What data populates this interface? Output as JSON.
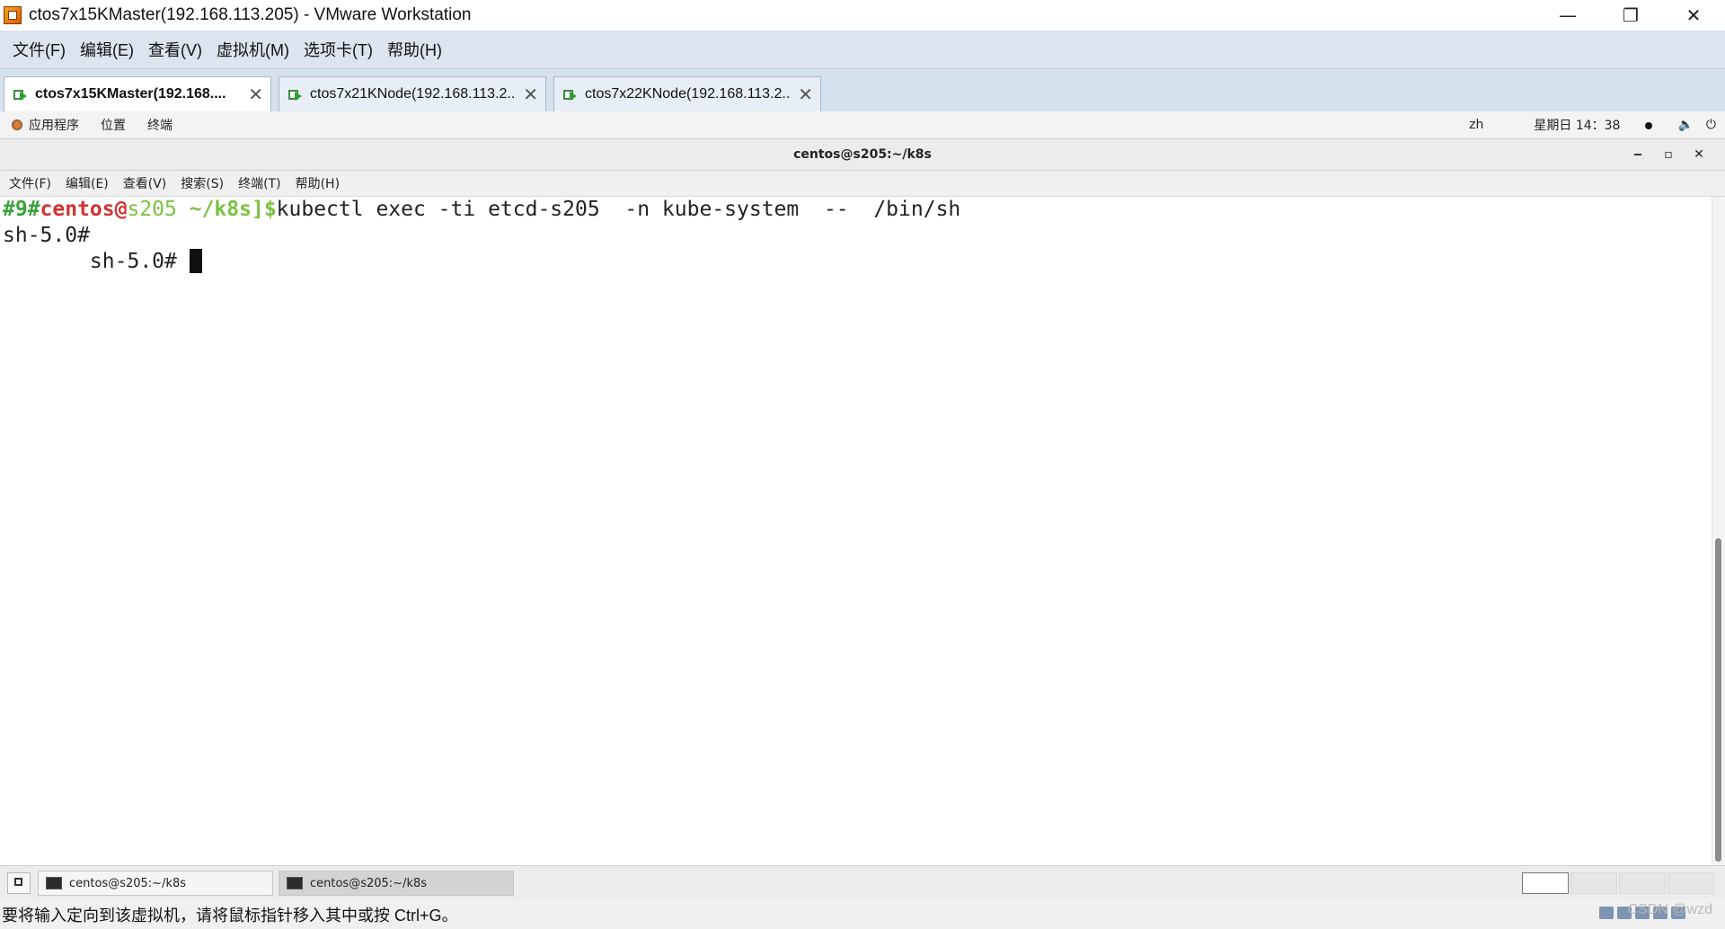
{
  "vmware": {
    "title": "ctos7x15KMaster(192.168.113.205) - VMware Workstation",
    "window_controls": {
      "minimize": "—",
      "restore": "❐",
      "close": "✕"
    },
    "menu": [
      "文件(F)",
      "编辑(E)",
      "查看(V)",
      "虚拟机(M)",
      "选项卡(T)",
      "帮助(H)"
    ],
    "tabs": [
      {
        "label": "ctos7x15KMaster(192.168....",
        "active": true
      },
      {
        "label": "ctos7x21KNode(192.168.113.2...",
        "active": false
      },
      {
        "label": "ctos7x22KNode(192.168.113.2...",
        "active": false
      }
    ],
    "tab_close": "✕",
    "status_text": "要将输入定向到该虚拟机，请将鼠标指针移入其中或按 Ctrl+G。",
    "watermark": "CSDN @wzd"
  },
  "gnome_bar": {
    "applications": "应用程序",
    "places": "位置",
    "terminal": "终端",
    "lang": "zh",
    "clock": "星期日 14：38",
    "volume_icon": "🔈",
    "power_icon": "⏻"
  },
  "terminal": {
    "window_title": "centos@s205:~/k8s",
    "controls": {
      "minimize": "‒",
      "maximize": "▫",
      "close": "✕"
    },
    "menu": [
      "文件(F)",
      "编辑(E)",
      "查看(V)",
      "搜索(S)",
      "终端(T)",
      "帮助(H)"
    ],
    "prompt": {
      "history": "#9#",
      "user": "centos@",
      "host": "s205",
      "dir": " ~/k8s]",
      "dollar": "$"
    },
    "command": "kubectl exec -ti etcd-s205  -n kube-system  --  /bin/sh",
    "line2": "sh-5.0#",
    "line3": "       sh-5.0# "
  },
  "taskbar": {
    "items": [
      {
        "label": "centos@s205:~/k8s",
        "active": false
      },
      {
        "label": "centos@s205:~/k8s",
        "active": true
      }
    ]
  }
}
